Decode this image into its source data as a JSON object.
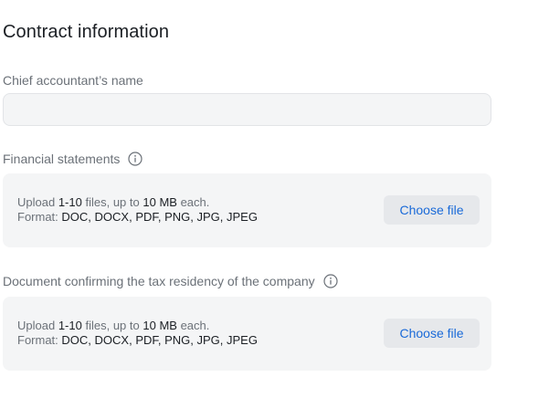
{
  "section": {
    "title": "Contract information"
  },
  "accountant": {
    "label": "Chief accountant’s name",
    "value": "",
    "placeholder": ""
  },
  "financial": {
    "label": "Financial statements",
    "info_icon": "info-circle-icon",
    "upload": {
      "prefix": "Upload",
      "count": "1-10",
      "mid": "files, up to",
      "size": "10 MB",
      "suffix": "each.",
      "format_label": "Format:",
      "formats": "DOC, DOCX, PDF, PNG, JPG, JPEG"
    },
    "button_label": "Choose file"
  },
  "tax": {
    "label": "Document confirming the tax residency of the company",
    "info_icon": "info-circle-icon",
    "upload": {
      "prefix": "Upload",
      "count": "1-10",
      "mid": "files, up to",
      "size": "10 MB",
      "suffix": "each.",
      "format_label": "Format:",
      "formats": "DOC, DOCX, PDF, PNG, JPG, JPEG"
    },
    "button_label": "Choose file"
  },
  "colors": {
    "accent": "#1a6ad8",
    "muted_text": "#6b7178",
    "box_background": "#f4f5f6"
  }
}
